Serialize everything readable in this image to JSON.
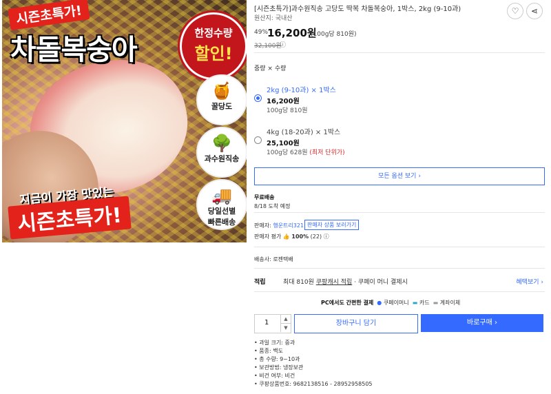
{
  "image": {
    "top_tag": "시즌초특가!",
    "title": "차돌복숭아",
    "badge_line1": "한정수량",
    "badge_line2": "할인!",
    "circle1": "꿀당도",
    "circle2": "과수원직송",
    "circle3_line1": "당일선별",
    "circle3_line2": "빠른배송",
    "bottom_line1": "지금이 가장 맛있는",
    "bottom_line2": "시즌초특가!"
  },
  "product": {
    "title": "[시즌초특가]과수원직송 고당도 딱복 차돌복숭아, 1박스, 2kg (9-10과)",
    "origin": "원산지: 국내산",
    "discount": "49%",
    "price": "16,200원",
    "unit_price": "(100g당 810원)",
    "original_price": "32,100원",
    "info_icon": "ⓘ"
  },
  "options": {
    "label": "중량 × 수량",
    "items": [
      {
        "name": "2kg (9-10과) × 1박스",
        "price": "16,200원",
        "unit": "100g당 810원",
        "note": "",
        "selected": true
      },
      {
        "name": "4kg (18-20과) × 1박스",
        "price": "25,100원",
        "unit": "100g당 628원",
        "note": "(최저 단위가)",
        "selected": false
      }
    ],
    "all_options_button": "모든 옵션 보기 ›"
  },
  "shipping": {
    "free": "무료배송",
    "arrival": "8/18 도착 예정"
  },
  "seller": {
    "label": "판매자:",
    "name": "행운트리321",
    "link": "판매자 상품 보러가기",
    "rating_label": "판매자 평가",
    "rating_value": "100%",
    "rating_count": "(22)",
    "courier": "배송사: 로젠택배"
  },
  "cash": {
    "label": "적립",
    "text_prefix": "최대 810원",
    "text_link": "쿠팡캐시 적립",
    "text_suffix": "· 쿠페이 머니 결제시",
    "benefit": "혜택보기 ›"
  },
  "payment": {
    "title": "PC에서도 간편한 결제",
    "methods": [
      "쿠페이머니",
      "카드",
      "계좌이체"
    ]
  },
  "purchase": {
    "quantity": "1",
    "cart_button": "장바구니 담기",
    "buy_button": "바로구매 ›"
  },
  "specs": [
    "과일 크기: 중과",
    "품종: 백도",
    "총 수량: 9~10과",
    "보관방법: 냉장보관",
    "비건 여부: 비건",
    "쿠팡상품번호: 9682138516 - 28952958505"
  ],
  "colors": {
    "accent": "#346aff",
    "sale_red": "#e3231b",
    "lowest_red": "#e52528"
  }
}
